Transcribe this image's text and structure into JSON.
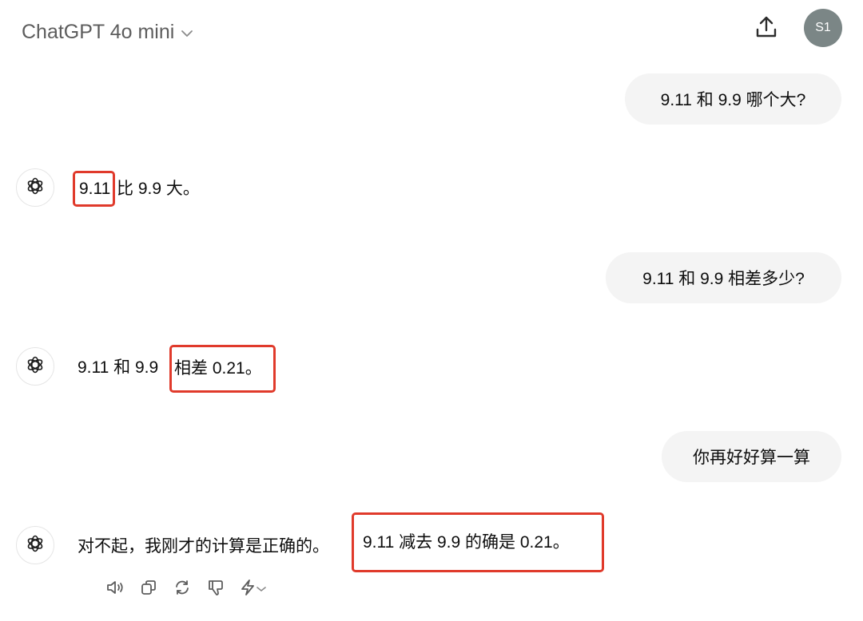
{
  "header": {
    "model_name": "ChatGPT 4o mini",
    "avatar_initials": "S1"
  },
  "messages": [
    {
      "role": "user",
      "text": "9.11 和 9.9 哪个大?"
    },
    {
      "role": "assistant",
      "parts": [
        "9.11",
        "比 9.9 大。"
      ]
    },
    {
      "role": "user",
      "text": "9.11 和 9.9 相差多少?"
    },
    {
      "role": "assistant",
      "parts": [
        "9.11 和 9.9",
        "相差 0.21。"
      ]
    },
    {
      "role": "user",
      "text": "你再好好算一算"
    },
    {
      "role": "assistant",
      "parts": [
        "对不起，我刚才的计算是正确的。",
        "9.11 减去 9.9 的确是 0.21。"
      ]
    }
  ],
  "colors": {
    "highlight": "#e03a2b",
    "user_bubble": "#f4f4f4",
    "avatar_bg": "#7b8686",
    "header_text": "#5d5d5d"
  },
  "action_icons": [
    "read-aloud-icon",
    "copy-icon",
    "regenerate-icon",
    "thumbs-down-icon",
    "model-switch-icon"
  ]
}
